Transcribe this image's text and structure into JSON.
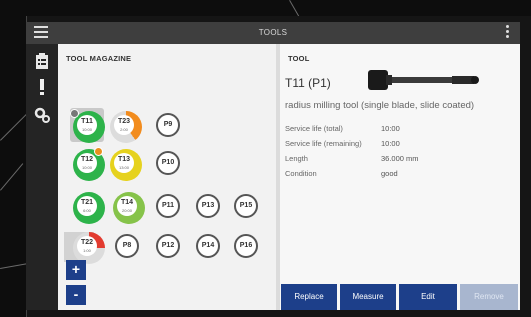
{
  "header": {
    "title": "TOOLS"
  },
  "magazine": {
    "title": "TOOL MAGAZINE",
    "slots": [
      {
        "label": "T11",
        "sub": "10:00",
        "ring": "#2db34a",
        "type": "tool",
        "selected": true
      },
      {
        "label": "T23",
        "sub": "2:00",
        "ring": "conic-gradient(#f28c1e 0 40%, #dcdcdc 40% 100%)",
        "type": "tool"
      },
      {
        "label": "P9"
      },
      {
        "label": "T12",
        "sub": "10:00",
        "ring": "#2db34a",
        "type": "tool"
      },
      {
        "label": "T13",
        "sub": "13:00",
        "ring": "#e6d21e",
        "type": "tool"
      },
      {
        "label": "P10"
      },
      {
        "label": "T21",
        "sub": "6:00",
        "ring": "#2db34a",
        "type": "tool"
      },
      {
        "label": "T14",
        "sub": "20:00",
        "ring": "#86c34a",
        "type": "tool"
      },
      {
        "label": "P11"
      },
      {
        "label": "P13"
      },
      {
        "label": "P15"
      },
      {
        "label": "T22",
        "sub": "1:00",
        "ring": "conic-gradient(#e23b2f 0 25%, #dcdcdc 25% 100%)",
        "type": "tool"
      },
      {
        "label": "P8"
      },
      {
        "label": "P12"
      },
      {
        "label": "P14"
      },
      {
        "label": "P16"
      }
    ],
    "zoom_in": "+",
    "zoom_out": "-"
  },
  "tool": {
    "section_title": "TOOL",
    "name": "T11 (P1)",
    "description": "radius milling tool (single blade, slide coated)",
    "properties": [
      {
        "label": "Service life (total)",
        "value": "10:00"
      },
      {
        "label": "Service life (remaining)",
        "value": "10:00"
      },
      {
        "label": "Length",
        "value": "36.000 mm"
      },
      {
        "label": "Condition",
        "value": "good"
      }
    ]
  },
  "actions": {
    "replace": "Replace",
    "measure": "Measure",
    "edit": "Edit",
    "remove": "Remove"
  }
}
